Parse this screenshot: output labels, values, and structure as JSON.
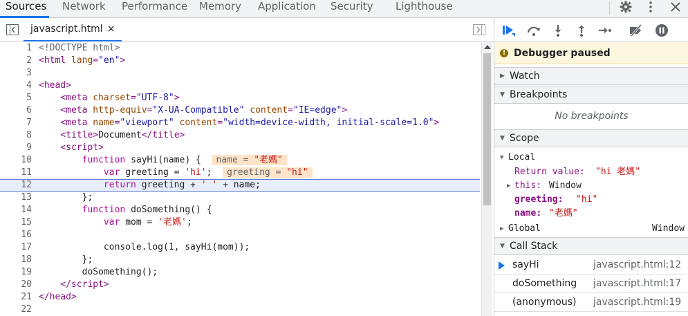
{
  "top_tabs": [
    "Sources",
    "Network",
    "Performance",
    "Memory",
    "Application",
    "Security",
    "Lighthouse"
  ],
  "active_tab": "Sources",
  "file_tab": {
    "name": "javascript.html",
    "close": "×"
  },
  "debugger": {
    "status": "Debugger paused",
    "sections": {
      "watch": "Watch",
      "breakpoints": "Breakpoints",
      "scope": "Scope",
      "call_stack": "Call Stack"
    },
    "no_breakpoints": "No breakpoints",
    "scope": {
      "local_label": "Local",
      "return_key": "Return value",
      "return_val": "\"hi 老媽\"",
      "this_key": "this",
      "this_val": "Window",
      "greeting_key": "greeting",
      "greeting_val": "\"hi\"",
      "name_key": "name",
      "name_val": "\"老媽\"",
      "global_label": "Global",
      "global_val": "Window"
    },
    "call_stack": [
      {
        "fn": "sayHi",
        "loc": "javascript.html:12",
        "current": true
      },
      {
        "fn": "doSomething",
        "loc": "javascript.html:17",
        "current": false
      },
      {
        "fn": "(anonymous)",
        "loc": "javascript.html:19",
        "current": false
      }
    ]
  },
  "code_lines": [
    {
      "n": "1",
      "html": "<span class=\"doct\">&lt;!DOCTYPE html&gt;</span>"
    },
    {
      "n": "2",
      "html": "<span class=\"tag\">&lt;html</span> <span class=\"attr\">lang</span><span class=\"tag\">=</span><span class=\"val\">\"en\"</span><span class=\"tag\">&gt;</span>"
    },
    {
      "n": "3",
      "html": ""
    },
    {
      "n": "4",
      "html": "<span class=\"tag\">&lt;head&gt;</span>"
    },
    {
      "n": "5",
      "html": "    <span class=\"tag\">&lt;meta</span> <span class=\"attr\">charset</span><span class=\"tag\">=</span><span class=\"val\">\"UTF-8\"</span><span class=\"tag\">&gt;</span>"
    },
    {
      "n": "6",
      "html": "    <span class=\"tag\">&lt;meta</span> <span class=\"attr\">http-equiv</span><span class=\"tag\">=</span><span class=\"val\">\"X-UA-Compatible\"</span> <span class=\"attr\">content</span><span class=\"tag\">=</span><span class=\"val\">\"IE=edge\"</span><span class=\"tag\">&gt;</span>"
    },
    {
      "n": "7",
      "html": "    <span class=\"tag\">&lt;meta</span> <span class=\"attr\">name</span><span class=\"tag\">=</span><span class=\"val\">\"viewport\"</span> <span class=\"attr\">content</span><span class=\"tag\">=</span><span class=\"val\">\"width=device-width, initial-scale=1.0\"</span><span class=\"tag\">&gt;</span>"
    },
    {
      "n": "8",
      "html": "    <span class=\"tag\">&lt;title&gt;</span>Document<span class=\"tag\">&lt;/title&gt;</span>"
    },
    {
      "n": "9",
      "html": "    <span class=\"tag\">&lt;script&gt;</span>"
    },
    {
      "n": "10",
      "html": "        <span class=\"kw\">function</span> sayHi(name) {  <span class=\"inline-val\">name = <span class=\"s\">\"老媽\"</span></span>"
    },
    {
      "n": "11",
      "html": "            <span class=\"kw\">var</span> greeting = <span class=\"str\">'hi'</span>;  <span class=\"inline-val\">greeting = <span class=\"s\">\"hi\"</span></span>"
    },
    {
      "n": "12",
      "html": "            <span class=\"kw\">return</span> greeting + <span class=\"str\">' '</span> + name;"
    },
    {
      "n": "13",
      "html": "        };"
    },
    {
      "n": "14",
      "html": "        <span class=\"kw\">function</span> doSomething() {"
    },
    {
      "n": "15",
      "html": "            <span class=\"kw\">var</span> mom = <span class=\"str\">'老媽'</span>;"
    },
    {
      "n": "16",
      "html": ""
    },
    {
      "n": "17",
      "html": "            console.log(1, sayHi(mom));"
    },
    {
      "n": "18",
      "html": "        };"
    },
    {
      "n": "19",
      "html": "        doSomething();"
    },
    {
      "n": "20",
      "html": "    <span class=\"tag\">&lt;/script&gt;</span>"
    },
    {
      "n": "21",
      "html": "<span class=\"tag\">&lt;/head&gt;</span>"
    },
    {
      "n": "22",
      "html": ""
    }
  ],
  "highlight_line": 12,
  "colors": {
    "accent": "#1a73e8",
    "paused_bg": "#fef7e0"
  }
}
